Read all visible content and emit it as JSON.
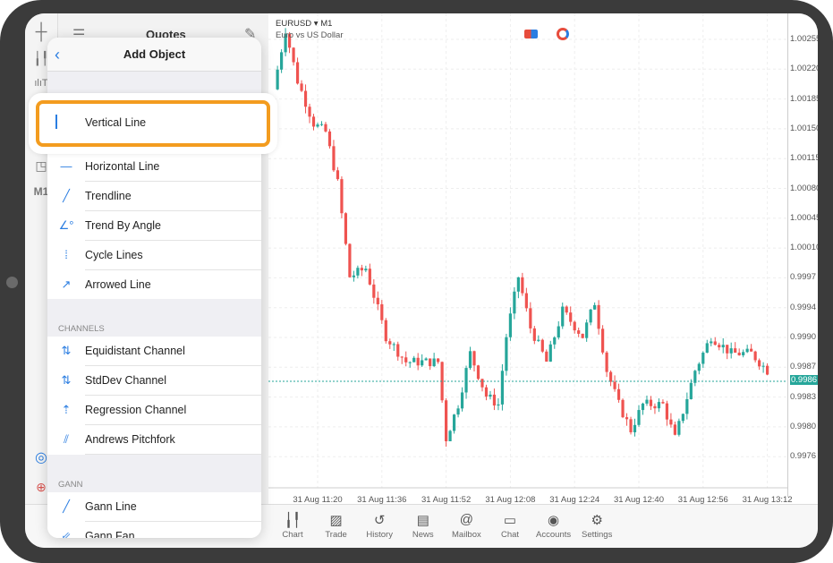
{
  "toolbar": {
    "timeframe": "M1"
  },
  "quotes": {
    "title": "Quotes"
  },
  "chart_header": {
    "symbol": "EURUSD",
    "timeframe": "M1",
    "description": "Euro vs US Dollar"
  },
  "panel": {
    "title": "Add Object",
    "highlighted": "Vertical Line",
    "lines": [
      "Horizontal Line",
      "Trendline",
      "Trend By Angle",
      "Cycle Lines",
      "Arrowed Line"
    ],
    "channels_label": "CHANNELS",
    "channels": [
      "Equidistant Channel",
      "StdDev Channel",
      "Regression Channel",
      "Andrews Pitchfork"
    ],
    "gann_label": "GANN",
    "gann": [
      "Gann Line",
      "Gann Fan"
    ]
  },
  "price_axis": [
    "1.00255",
    "1.00220",
    "1.00185",
    "1.00150",
    "1.00115",
    "1.00080",
    "1.00045",
    "1.00010",
    "0.9997",
    "0.9994",
    "0.9990",
    "0.9987",
    "0.9983",
    "0.9980",
    "0.9976"
  ],
  "current_price": "0.9986",
  "time_axis": [
    "31 Aug 11:20",
    "31 Aug 11:36",
    "31 Aug 11:52",
    "31 Aug 12:08",
    "31 Aug 12:24",
    "31 Aug 12:40",
    "31 Aug 12:56",
    "31 Aug 13:12"
  ],
  "tabs": [
    "Chart",
    "Trade",
    "History",
    "News",
    "Mailbox",
    "Chat",
    "Accounts",
    "Settings"
  ],
  "colors": {
    "bull": "#26a69a",
    "bear": "#ef5350",
    "accent": "#2a7de1",
    "highlight": "#f39c1f"
  },
  "chart_data": {
    "type": "candlestick",
    "symbol": "EURUSD",
    "timeframe": "M1",
    "close_keypoints": [
      [
        "11:09",
        1.0019
      ],
      [
        "11:12",
        1.0026
      ],
      [
        "11:15",
        1.002
      ],
      [
        "11:19",
        1.0015
      ],
      [
        "11:22",
        1.0014
      ],
      [
        "11:25",
        1.0008
      ],
      [
        "11:28",
        0.9997
      ],
      [
        "11:32",
        0.9998
      ],
      [
        "11:37",
        0.999
      ],
      [
        "11:42",
        0.9987
      ],
      [
        "11:50",
        0.9987
      ],
      [
        "11:52",
        0.9978
      ],
      [
        "11:55",
        0.9982
      ],
      [
        "11:58",
        0.9988
      ],
      [
        "12:02",
        0.9983
      ],
      [
        "12:05",
        0.9982
      ],
      [
        "12:07",
        0.999
      ],
      [
        "12:10",
        0.9997
      ],
      [
        "12:13",
        0.9991
      ],
      [
        "12:17",
        0.9987
      ],
      [
        "12:21",
        0.9993
      ],
      [
        "12:26",
        0.999
      ],
      [
        "12:29",
        0.9994
      ],
      [
        "12:32",
        0.9986
      ],
      [
        "12:35",
        0.9982
      ],
      [
        "12:38",
        0.9979
      ],
      [
        "12:41",
        0.9982
      ],
      [
        "12:46",
        0.9982
      ],
      [
        "12:49",
        0.9978
      ],
      [
        "12:54",
        0.9986
      ],
      [
        "12:58",
        0.999
      ],
      [
        "13:03",
        0.9988
      ],
      [
        "13:08",
        0.9988
      ],
      [
        "13:12",
        0.9986
      ]
    ],
    "ylim": [
      0.99745,
      1.0028
    ]
  }
}
